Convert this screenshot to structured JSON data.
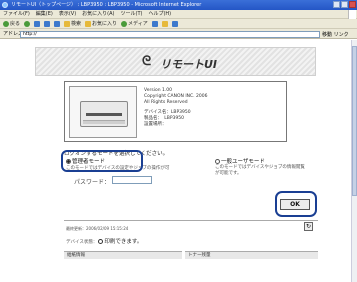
{
  "window": {
    "title": "リモートUI（トップページ） : LBP3950 : LBP3950 - Microsoft Internet Explorer"
  },
  "menubar": {
    "items": [
      "ファイル(F)",
      "編集(E)",
      "表示(V)",
      "お気に入り(A)",
      "ツール(T)",
      "ヘルプ(H)"
    ]
  },
  "toolbar": {
    "back": "戻る",
    "search": "検索",
    "favorites": "お気に入り",
    "media": "メディア"
  },
  "addressbar": {
    "label": "アドレス(D)",
    "url": "http://",
    "go": "移動",
    "links": "リンク"
  },
  "banner": {
    "title": "リモートUI"
  },
  "device": {
    "version": "Version 1.00",
    "copyright": "Copyright CANON INC. 2006",
    "rights": "All Rights Reserved",
    "device_name": "デバイス名：LBP3950",
    "product_name": "製品名：　LBP3950",
    "location": "設置場所："
  },
  "login": {
    "instruction": "ログオンするモードを選択してください。",
    "admin_mode": "管理者モード",
    "admin_desc": "このモードではデバイスの設定やジョブの操作が可",
    "user_mode": "一般ユーザモード",
    "user_desc": "このモードではデバイスやジョブの情報閲覧が可能です。",
    "password_label": "パスワード：",
    "ok_button": "OK"
  },
  "status": {
    "last_update": "最終更新：2006/02/09 15:15:24",
    "device_status_label": "デバイス状態：",
    "device_status_value": "印刷できます。",
    "section_left": "給紙情報",
    "section_right": "トナー残量"
  }
}
